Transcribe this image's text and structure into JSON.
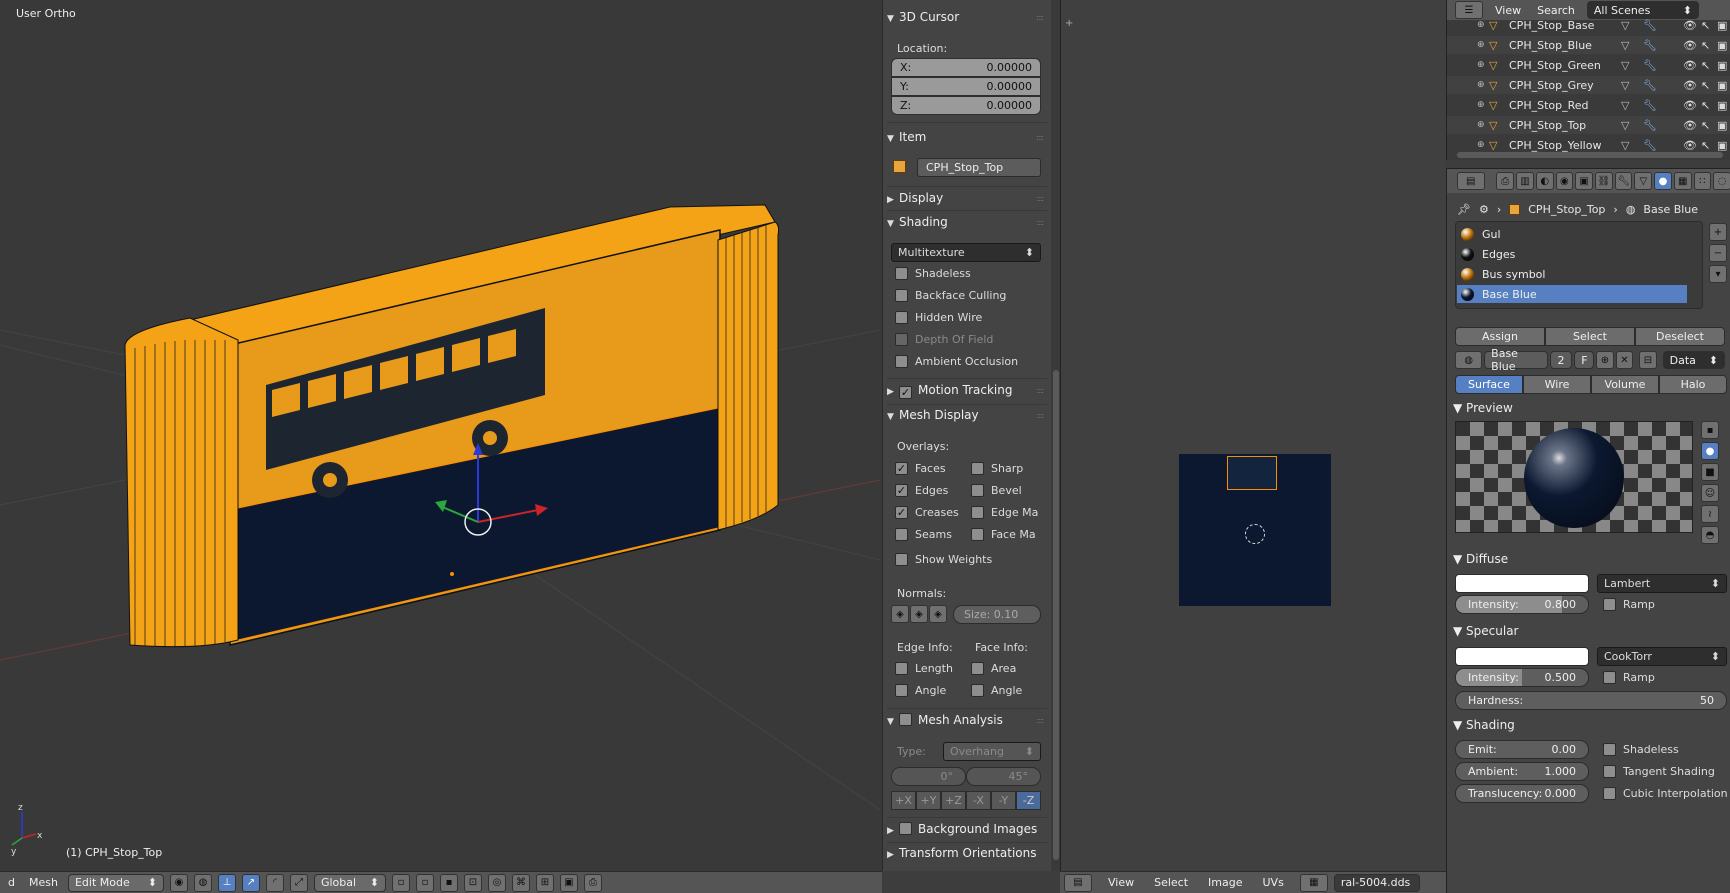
{
  "viewport": {
    "view_label": "User Ortho",
    "object_label": "(1) CPH_Stop_Top"
  },
  "viewport_header": {
    "menu_partial": "d",
    "menu_mesh": "Mesh",
    "mode": "Edit Mode",
    "orientation": "Global"
  },
  "npanel": {
    "cursor_title": "3D Cursor",
    "location_label": "Location:",
    "x_label": "X:",
    "x_value": "0.00000",
    "y_label": "Y:",
    "y_value": "0.00000",
    "z_label": "Z:",
    "z_value": "0.00000",
    "item_title": "Item",
    "item_name": "CPH_Stop_Top",
    "display_title": "Display",
    "shading_title": "Shading",
    "shading_mode": "Multitexture",
    "shadeless": "Shadeless",
    "backface": "Backface Culling",
    "hidden_wire": "Hidden Wire",
    "dof": "Depth Of Field",
    "ao": "Ambient Occlusion",
    "motion_tracking": "Motion Tracking",
    "mesh_display": "Mesh Display",
    "overlays": "Overlays:",
    "faces": "Faces",
    "sharp": "Sharp",
    "edges": "Edges",
    "bevel": "Bevel",
    "creases": "Creases",
    "edge_marks": "Edge Ma",
    "seams": "Seams",
    "face_marks": "Face Ma",
    "show_weights": "Show Weights",
    "normals": "Normals:",
    "normal_size": "Size:  0.10",
    "edge_info": "Edge Info:",
    "face_info": "Face Info:",
    "length": "Length",
    "area": "Area",
    "angle_e": "Angle",
    "angle_f": "Angle",
    "mesh_analysis": "Mesh Analysis",
    "type_label": "Type:",
    "type_value": "Overhang",
    "range_min": "0°",
    "range_max": "45°",
    "axes": [
      "+X",
      "+Y",
      "+Z",
      "-X",
      "-Y",
      "-Z"
    ],
    "background_images": "Background Images",
    "transform_orientations": "Transform Orientations"
  },
  "uv_header": {
    "view": "View",
    "select": "Select",
    "image": "Image",
    "uvs": "UVs",
    "image_name": "ral-5004.dds"
  },
  "outliner": {
    "view": "View",
    "search": "Search",
    "scenes": "All Scenes",
    "rows": [
      "CPH_Stop_Base",
      "CPH_Stop_Blue",
      "CPH_Stop_Green",
      "CPH_Stop_Grey",
      "CPH_Stop_Red",
      "CPH_Stop_Top",
      "CPH_Stop_Yellow"
    ]
  },
  "props": {
    "breadcrumb_object": "CPH_Stop_Top",
    "breadcrumb_material": "Base Blue",
    "materials": [
      {
        "name": "Gul",
        "color": "#c67a10"
      },
      {
        "name": "Edges",
        "color": "#111111"
      },
      {
        "name": "Bus symbol",
        "color": "#c67a10"
      },
      {
        "name": "Base Blue",
        "color": "#0b1830"
      }
    ],
    "assign": "Assign",
    "select": "Select",
    "deselect": "Deselect",
    "mat_name": "Base Blue",
    "mat_users": "2",
    "mat_fake": "F",
    "data_link": "Data",
    "tabs": [
      "Surface",
      "Wire",
      "Volume",
      "Halo"
    ],
    "preview_title": "Preview",
    "diffuse_title": "Diffuse",
    "diffuse_shader": "Lambert",
    "diffuse_intensity_label": "Intensity:",
    "diffuse_intensity": "0.800",
    "diffuse_intensity_value": 0.8,
    "ramp": "Ramp",
    "specular_title": "Specular",
    "specular_shader": "CookTorr",
    "specular_intensity_label": "Intensity:",
    "specular_intensity": "0.500",
    "specular_intensity_value": 0.5,
    "hardness_label": "Hardness:",
    "hardness": "50",
    "shading_title": "Shading",
    "emit_label": "Emit:",
    "emit": "0.00",
    "ambient_label": "Ambient:",
    "ambient": "1.000",
    "translucency_label": "Translucency:",
    "translucency": "0.000",
    "shadeless": "Shadeless",
    "tangent": "Tangent Shading",
    "cubic": "Cubic Interpolation"
  },
  "colors": {
    "accent": "#5680c2",
    "sign_orange": "#f5a316",
    "sign_blue": "#0b1830",
    "selection": "#ff8c00"
  }
}
